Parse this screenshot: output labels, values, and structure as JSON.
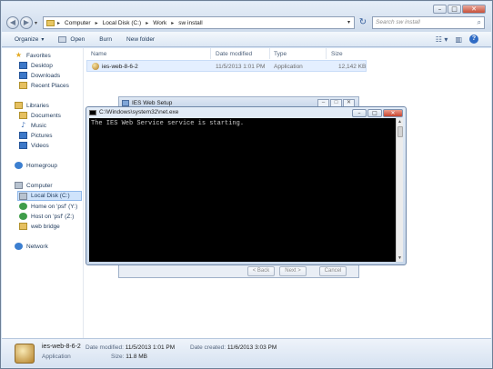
{
  "explorer": {
    "breadcrumb": [
      "Computer",
      "Local Disk (C:)",
      "Work",
      "sw install"
    ],
    "search_placeholder": "Search sw install",
    "toolbar": {
      "organize": "Organize",
      "open": "Open",
      "burn": "Burn",
      "new_folder": "New folder"
    },
    "nav": {
      "favorites": "Favorites",
      "desktop": "Desktop",
      "downloads": "Downloads",
      "recent_places": "Recent Places",
      "libraries": "Libraries",
      "documents": "Documents",
      "music": "Music",
      "pictures": "Pictures",
      "videos": "Videos",
      "homegroup": "Homegroup",
      "computer": "Computer",
      "local_disk": "Local Disk (C:)",
      "home_psf": "Home on 'psf' (Y:)",
      "host_psf": "Host on 'psf' (Z:)",
      "web_bridge": "web bridge",
      "network": "Network"
    },
    "columns": {
      "name": "Name",
      "date_modified": "Date modified",
      "type": "Type",
      "size": "Size"
    },
    "file": {
      "name": "ies-web-8-6-2",
      "date_modified": "11/5/2013 1:01 PM",
      "type": "Application",
      "size": "12,142 KB"
    },
    "details": {
      "name": "ies-web-8-6-2",
      "type": "Application",
      "date_modified_label": "Date modified:",
      "date_modified": "11/5/2013 1:01 PM",
      "date_created_label": "Date created:",
      "date_created": "11/6/2013 3:03 PM",
      "size_label": "Size:",
      "size": "11.8 MB"
    }
  },
  "setup_dialog": {
    "title": "IES Web Setup",
    "back": "< Back",
    "next": "Next >",
    "cancel": "Cancel"
  },
  "console": {
    "title": "C:\\Windows\\system32\\net.exe",
    "output": "The IES Web Service service is starting."
  }
}
